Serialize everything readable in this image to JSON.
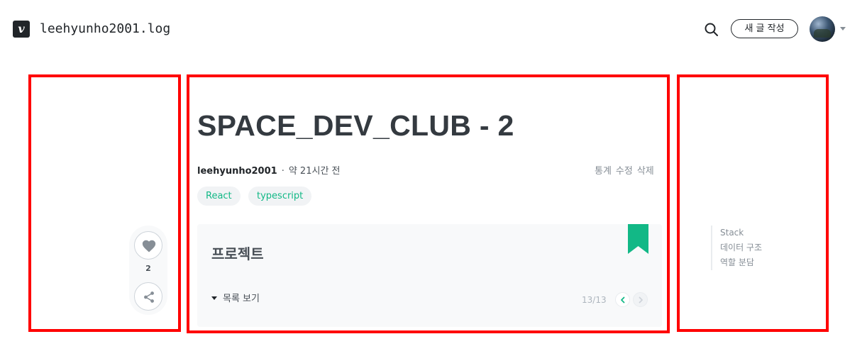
{
  "header": {
    "logo_letter": "v",
    "blog_name": "leehyunho2001.log",
    "new_post_label": "새 글 작성"
  },
  "actions": {
    "like_count": "2"
  },
  "post": {
    "title": "SPACE_DEV_CLUB - 2",
    "author": "leehyunho2001",
    "separator": "·",
    "time_ago": "약 21시간 전",
    "owner_actions": [
      "통계",
      "수정",
      "삭제"
    ],
    "tags": [
      "React",
      "typescript"
    ]
  },
  "series": {
    "name": "프로젝트",
    "toggle_label": "목록 보기",
    "progress": "13/13"
  },
  "toc": {
    "items": [
      "Stack",
      "데이터 구조",
      "역할 분담"
    ]
  },
  "colors": {
    "accent": "#12b886",
    "annotation": "#ff0000",
    "text": "#212529"
  },
  "icons": [
    "search-icon",
    "heart-icon",
    "share-icon",
    "bookmark-icon",
    "chevron-left-icon",
    "chevron-right-icon",
    "caret-down-icon"
  ]
}
